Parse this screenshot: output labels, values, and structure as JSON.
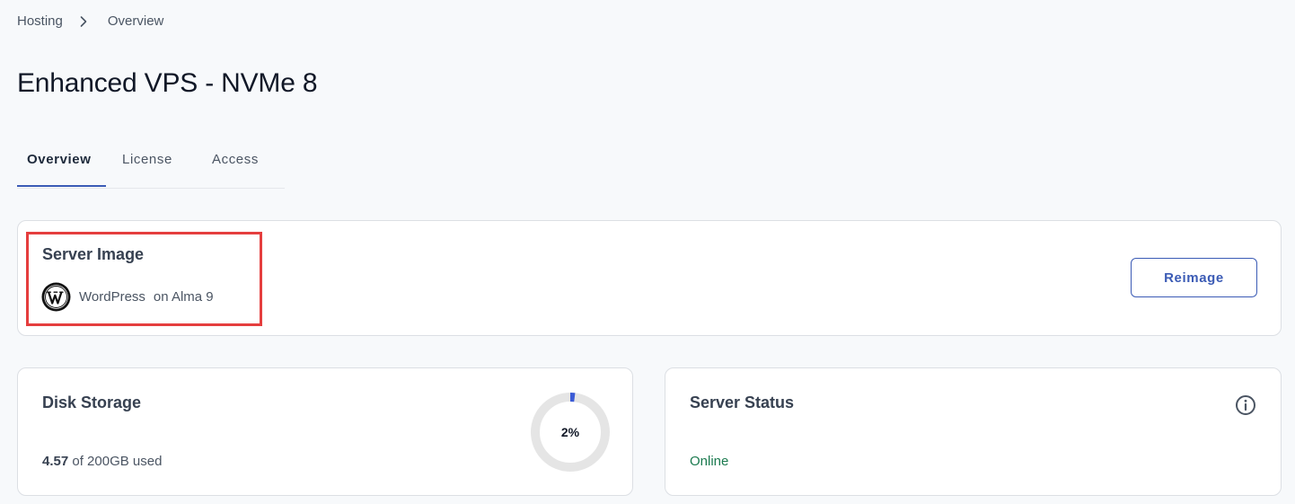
{
  "breadcrumb": {
    "items": [
      "Hosting",
      "Overview"
    ]
  },
  "page_title": "Enhanced VPS - NVMe 8",
  "tabs": [
    {
      "label": "Overview",
      "active": true
    },
    {
      "label": "License",
      "active": false
    },
    {
      "label": "Access",
      "active": false
    }
  ],
  "server_image": {
    "title": "Server Image",
    "app": "WordPress",
    "os": "on Alma 9",
    "icon": "wordpress-logo-icon",
    "action_label": "Reimage"
  },
  "disk_storage": {
    "title": "Disk Storage",
    "used_value": "4.57",
    "total_text": "of 200GB used",
    "percent_label": "2%",
    "percent": 2
  },
  "server_status": {
    "title": "Server Status",
    "status": "Online",
    "info_icon": "info-icon"
  },
  "colors": {
    "accent": "#3b5bb5",
    "highlight": "#e53e3e",
    "online": "#1b7a4f",
    "donut_track": "#e5e5e5",
    "donut_fill": "#3b5bd6"
  }
}
